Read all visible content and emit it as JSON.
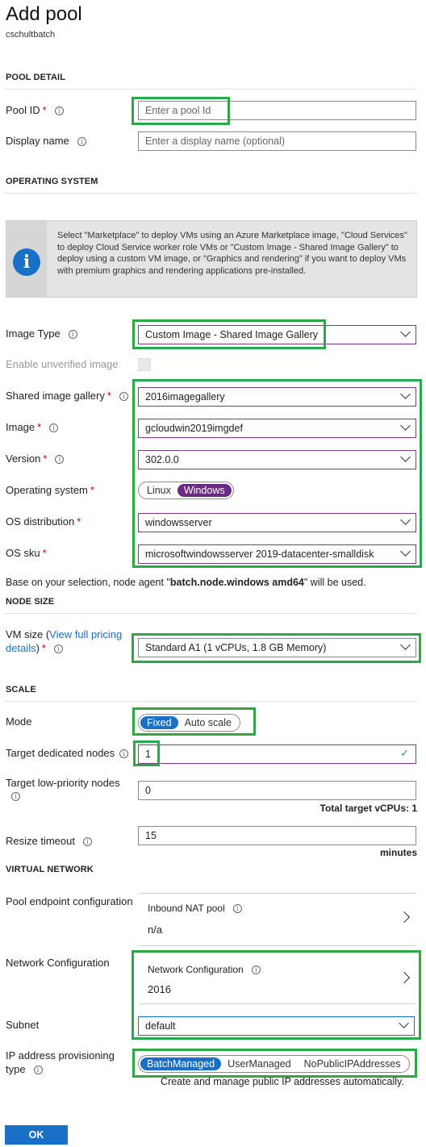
{
  "header": {
    "title": "Add pool",
    "subtitle": "cschultbatch"
  },
  "sections": {
    "pool_detail": "POOL DETAIL",
    "operating_system": "OPERATING SYSTEM",
    "node_size": "NODE SIZE",
    "scale": "SCALE",
    "virtual_network": "VIRTUAL NETWORK"
  },
  "pool_detail": {
    "pool_id_label": "Pool ID",
    "pool_id_placeholder": "Enter a pool Id",
    "display_name_label": "Display name",
    "display_name_placeholder": "Enter a display name (optional)"
  },
  "os_info": "Select \"Marketplace\" to deploy VMs using an Azure Marketplace image, \"Cloud Services\" to deploy Cloud Service worker role VMs or \"Custom Image - Shared Image Gallery\" to deploy using a custom VM image, or \"Graphics and rendering\" if you want to deploy VMs with premium graphics and rendering applications pre-installed.",
  "image_type": {
    "label": "Image Type",
    "value": "Custom Image - Shared Image Gallery"
  },
  "unverified": {
    "label": "Enable unverified image"
  },
  "gallery": {
    "label": "Shared image gallery",
    "value": "2016imagegallery"
  },
  "image": {
    "label": "Image",
    "value": "gcloudwin2019imgdef"
  },
  "version": {
    "label": "Version",
    "value": "302.0.0"
  },
  "operating_system": {
    "label": "Operating system",
    "options": [
      "Linux",
      "Windows"
    ],
    "selected": "Windows"
  },
  "os_distribution": {
    "label": "OS distribution",
    "value": "windowsserver"
  },
  "os_sku": {
    "label": "OS sku",
    "value": "microsoftwindowsserver 2019-datacenter-smalldisk"
  },
  "agent_note": {
    "prefix": "Base on your selection, node agent \"",
    "agent": "batch.node.windows amd64",
    "suffix": "\" will be used."
  },
  "vm_size": {
    "label_prefix": "VM size (",
    "link": "View full pricing details",
    "label_suffix": ")",
    "value": "Standard A1 (1 vCPUs, 1.8 GB Memory)"
  },
  "mode": {
    "label": "Mode",
    "options": [
      "Fixed",
      "Auto scale"
    ],
    "selected": "Fixed"
  },
  "dedicated": {
    "label": "Target dedicated nodes",
    "value": "1"
  },
  "low_priority": {
    "label": "Target low-priority nodes",
    "value": "0",
    "total": "Total target vCPUs: 1"
  },
  "resize": {
    "label": "Resize timeout",
    "value": "15",
    "unit": "minutes"
  },
  "endpoint": {
    "label": "Pool endpoint configuration",
    "card_title": "Inbound NAT pool",
    "card_value": "n/a"
  },
  "network": {
    "label": "Network Configuration",
    "card_title": "Network Configuration",
    "card_value": "2016"
  },
  "subnet": {
    "label": "Subnet",
    "value": "default"
  },
  "ip": {
    "label_line1": "IP address provisioning",
    "label_line2": "type",
    "options": [
      "BatchManaged",
      "UserManaged",
      "NoPublicIPAddresses"
    ],
    "selected": "BatchManaged",
    "description": "Create and manage public IP addresses automatically."
  },
  "ok_label": "OK",
  "colors": {
    "highlight": "#2aa84a",
    "accent_blue": "#1a6fc7",
    "accent_purple": "#6a2a82",
    "required": "#c00000"
  }
}
